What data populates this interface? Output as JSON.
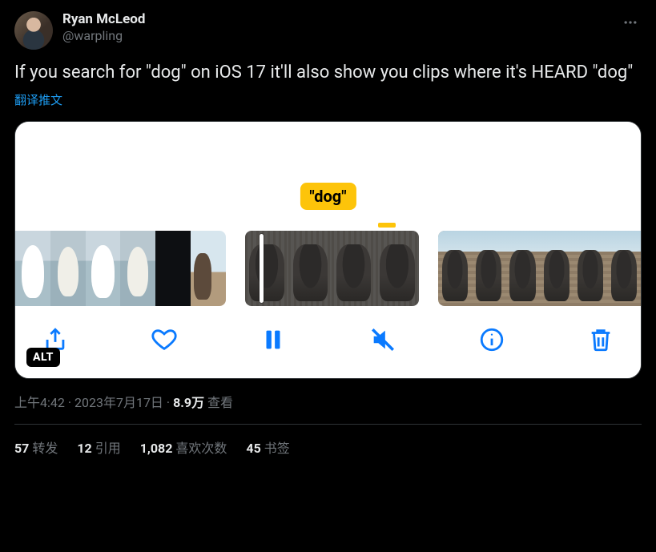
{
  "author": {
    "display_name": "Ryan McLeod",
    "handle": "@warpling"
  },
  "tweet_text": "If you search for \"dog\" on iOS 17 it'll also show you clips where it's HEARD \"dog\"",
  "translate_label": "翻译推文",
  "media": {
    "search_token_label": "\"dog\"",
    "alt_badge": "ALT"
  },
  "meta": {
    "time": "上午4:42",
    "date": "2023年7月17日",
    "views_count": "8.9万",
    "views_label": "查看"
  },
  "stats": {
    "retweets_n": "57",
    "retweets_label": "转发",
    "quotes_n": "12",
    "quotes_label": "引用",
    "likes_n": "1,082",
    "likes_label": "喜欢次数",
    "bookmarks_n": "45",
    "bookmarks_label": "书签"
  }
}
